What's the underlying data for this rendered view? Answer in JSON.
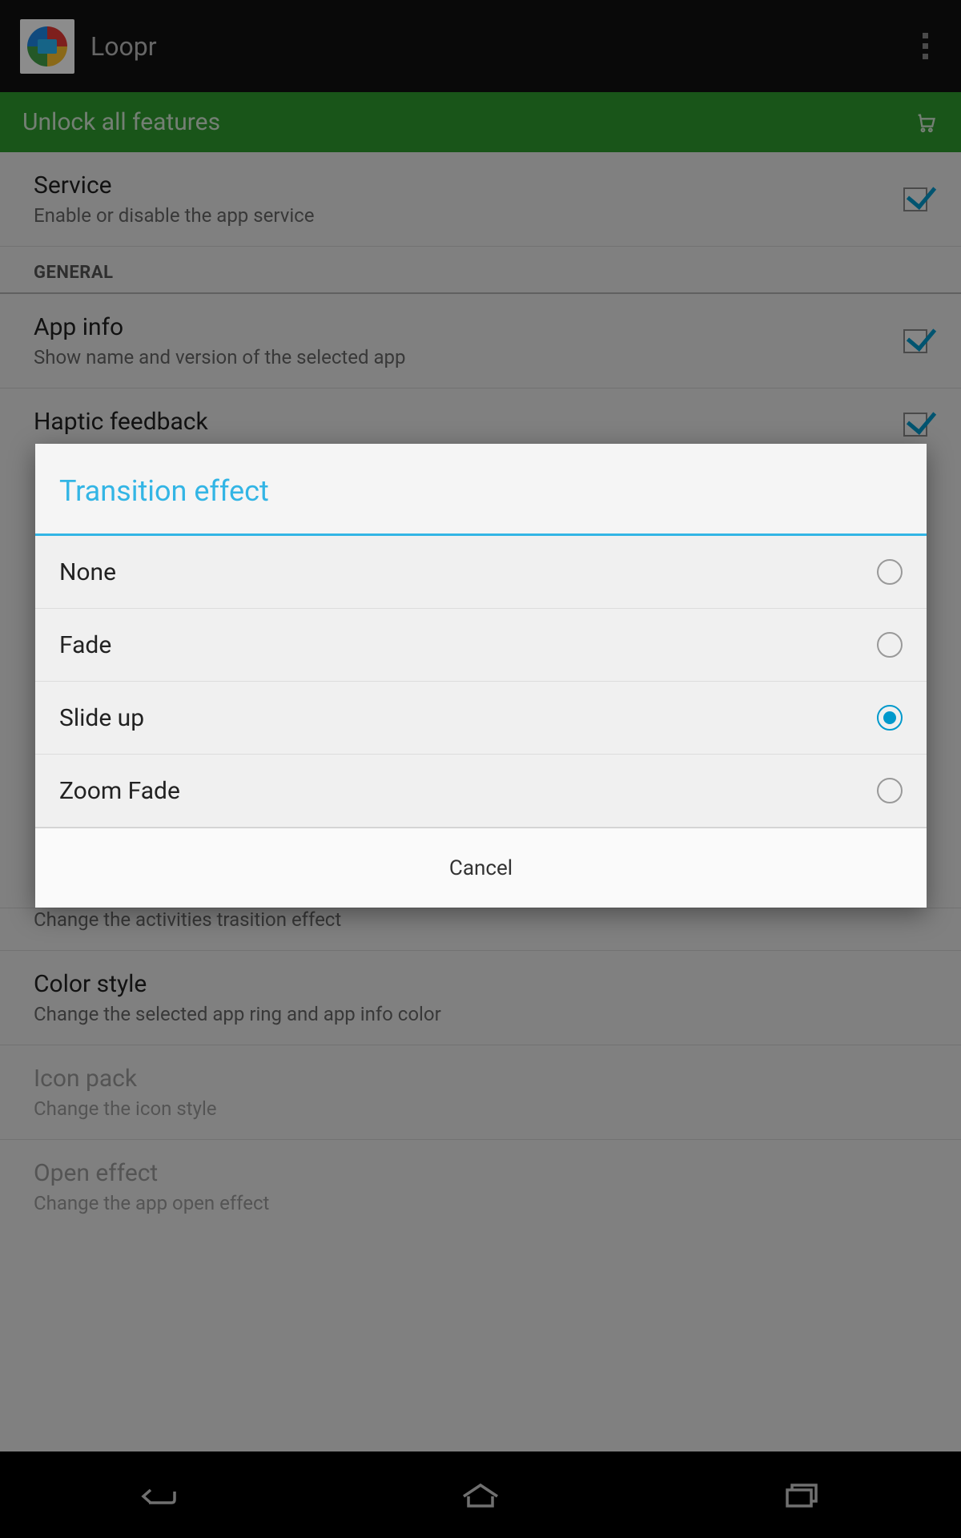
{
  "header": {
    "title": "Loopr"
  },
  "unlock_bar": {
    "label": "Unlock all features"
  },
  "settings": {
    "service": {
      "title": "Service",
      "subtitle": "Enable or disable the app service"
    },
    "section_general": "GENERAL",
    "app_info": {
      "title": "App info",
      "subtitle": "Show name and version of the selected app"
    },
    "haptic": {
      "title": "Haptic feedback"
    },
    "transition": {
      "title": "Transition effect",
      "subtitle": "Change the activities trasition effect"
    },
    "color": {
      "title": "Color style",
      "subtitle": "Change the selected app ring and app info color"
    },
    "icon_pack": {
      "title": "Icon pack",
      "subtitle": "Change the icon style"
    },
    "open_effect": {
      "title": "Open effect",
      "subtitle": "Change the app open effect"
    }
  },
  "dialog": {
    "title": "Transition effect",
    "options": [
      {
        "label": "None",
        "selected": false
      },
      {
        "label": "Fade",
        "selected": false
      },
      {
        "label": "Slide up",
        "selected": true
      },
      {
        "label": "Zoom Fade",
        "selected": false
      }
    ],
    "cancel": "Cancel"
  }
}
